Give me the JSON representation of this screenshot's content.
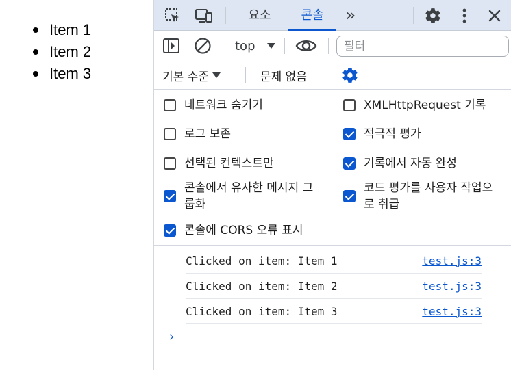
{
  "page": {
    "items": [
      "Item 1",
      "Item 2",
      "Item 3"
    ]
  },
  "devtools": {
    "tabs": [
      {
        "label": "요소",
        "active": false
      },
      {
        "label": "콘솔",
        "active": true
      }
    ],
    "more_tabs": "»",
    "toolbar": {
      "context": "top",
      "filter_placeholder": "필터",
      "log_level": "기본 수준",
      "issues": "문제 없음"
    },
    "settings": {
      "left": [
        {
          "label": "네트워크 숨기기",
          "checked": false
        },
        {
          "label": "로그 보존",
          "checked": false
        },
        {
          "label": "선택된 컨텍스트만",
          "checked": false
        },
        {
          "label": "콘솔에서 유사한 메시지 그룹화",
          "checked": true
        },
        {
          "label": "콘솔에 CORS 오류 표시",
          "checked": true
        }
      ],
      "right": [
        {
          "label": "XMLHttpRequest 기록",
          "checked": false
        },
        {
          "label": "적극적 평가",
          "checked": true
        },
        {
          "label": "기록에서 자동 완성",
          "checked": true
        },
        {
          "label": "코드 평가를 사용자 작업으로 취급",
          "checked": true
        }
      ]
    },
    "messages": [
      {
        "text": "Clicked on item: Item 1",
        "source": "test.js:3"
      },
      {
        "text": "Clicked on item: Item 2",
        "source": "test.js:3"
      },
      {
        "text": "Clicked on item: Item 3",
        "source": "test.js:3"
      }
    ],
    "prompt": "›"
  },
  "colors": {
    "accent": "#0b57d0",
    "tabbar_bg": "#dfe6f3"
  }
}
